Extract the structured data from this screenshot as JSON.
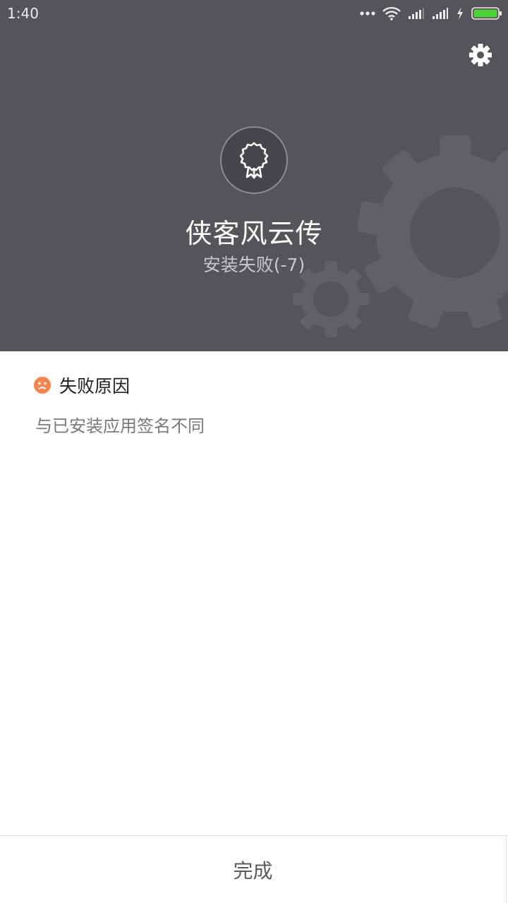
{
  "status_bar": {
    "time": "1:40",
    "icons": [
      "more-dots-icon",
      "wifi-icon",
      "signal-icon",
      "signal-icon",
      "charging-icon",
      "battery-icon"
    ],
    "battery_color": "#4cd137"
  },
  "header": {
    "background_color": "#555459",
    "settings_icon": "gear-icon",
    "app_icon": "certificate-badge-icon",
    "app_name": "侠客风云传",
    "install_status": "安装失败(-7)"
  },
  "failure": {
    "icon": "sad-face-icon",
    "icon_color": "#f5844c",
    "title": "失败原因",
    "reason": "与已安装应用签名不同"
  },
  "footer": {
    "done_label": "完成"
  }
}
